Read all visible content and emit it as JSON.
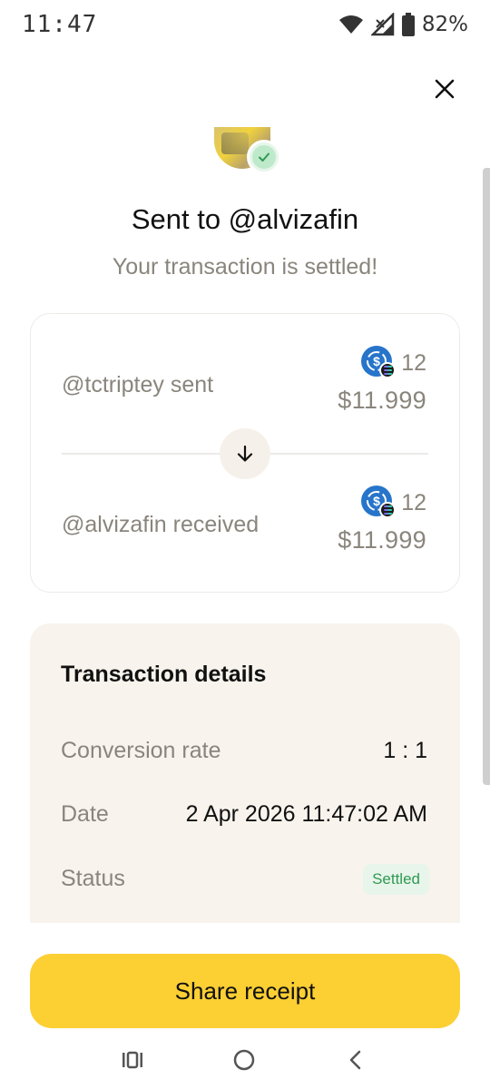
{
  "status_bar": {
    "time": "11:47",
    "battery_percent": "82%",
    "icons": [
      "wifi-icon",
      "signal-icon",
      "battery-icon"
    ]
  },
  "header": {
    "close_icon": "close-icon"
  },
  "hero": {
    "title": "Sent to @alvizafin",
    "subtitle": "Your transaction is settled!"
  },
  "transfer": {
    "sender": {
      "label": "@tctriptey sent",
      "token_amount": "12",
      "usd_amount": "$11.999"
    },
    "receiver": {
      "label": "@alvizafin received",
      "token_amount": "12",
      "usd_amount": "$11.999"
    },
    "token_icon": "usdc-coin-icon",
    "chain_icon": "solana-chain-icon"
  },
  "details": {
    "title": "Transaction details",
    "rows": [
      {
        "label": "Conversion rate",
        "value": "1 : 1"
      },
      {
        "label": "Date",
        "value": "2 Apr 2026 11:47:02 AM"
      },
      {
        "label": "Status",
        "value": "Settled"
      }
    ]
  },
  "actions": {
    "share_label": "Share receipt"
  },
  "colors": {
    "accent": "#fccf33",
    "success": "#2f9a53",
    "muted_text": "#8a857c",
    "details_bg": "#f8f4ed",
    "usdc_blue": "#2775ca"
  },
  "nav": {
    "icons": [
      "recent-apps-icon",
      "home-icon",
      "back-icon"
    ]
  }
}
